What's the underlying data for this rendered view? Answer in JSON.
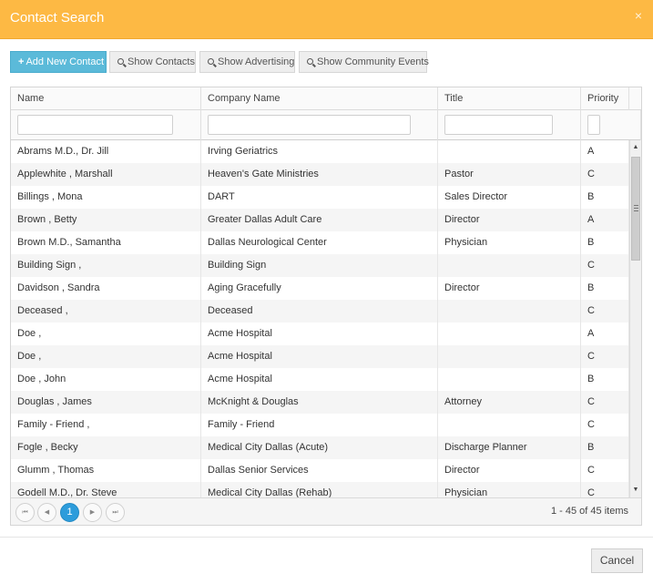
{
  "dialog": {
    "title": "Contact Search",
    "close_glyph": "×"
  },
  "toolbar": {
    "add_label": "Add New Contact",
    "show_contacts_label": "Show Contacts",
    "show_advertising_label": "Show Advertising",
    "show_events_label": "Show Community Events"
  },
  "grid": {
    "columns": [
      "Name",
      "Company Name",
      "Title",
      "Priority"
    ],
    "filters": {
      "name": "",
      "company": "",
      "title": "",
      "priority": ""
    },
    "rows": [
      [
        "Abrams M.D., Dr. Jill",
        "Irving Geriatrics",
        "",
        "A"
      ],
      [
        "Applewhite , Marshall",
        "Heaven's Gate Ministries",
        "Pastor",
        "C"
      ],
      [
        "Billings , Mona",
        "DART",
        "Sales Director",
        "B"
      ],
      [
        "Brown , Betty",
        "Greater Dallas Adult Care",
        "Director",
        "A"
      ],
      [
        "Brown M.D., Samantha",
        "Dallas Neurological Center",
        "Physician",
        "B"
      ],
      [
        "Building Sign ,",
        "Building Sign",
        "",
        "C"
      ],
      [
        "Davidson , Sandra",
        "Aging Gracefully",
        "Director",
        "B"
      ],
      [
        "Deceased ,",
        "Deceased",
        "",
        "C"
      ],
      [
        "Doe ,",
        "Acme Hospital",
        "",
        "A"
      ],
      [
        "Doe ,",
        "Acme Hospital",
        "",
        "C"
      ],
      [
        "Doe , John",
        "Acme Hospital",
        "",
        "B"
      ],
      [
        "Douglas , James",
        "McKnight & Douglas",
        "Attorney",
        "C"
      ],
      [
        "Family - Friend ,",
        "Family - Friend",
        "",
        "C"
      ],
      [
        "Fogle , Becky",
        "Medical City Dallas (Acute)",
        "Discharge Planner",
        "B"
      ],
      [
        "Glumm , Thomas",
        "Dallas Senior Services",
        "Director",
        "C"
      ],
      [
        "Godell M.D., Dr. Steve",
        "Medical City Dallas (Rehab)",
        "Physician",
        "C"
      ]
    ]
  },
  "pager": {
    "current_page": "1",
    "info": "1 - 45 of 45 items"
  },
  "footer": {
    "cancel_label": "Cancel"
  },
  "colors": {
    "title_bar": "#fdb944",
    "primary_button": "#5bbad9",
    "active_page": "#2d9cdb"
  }
}
